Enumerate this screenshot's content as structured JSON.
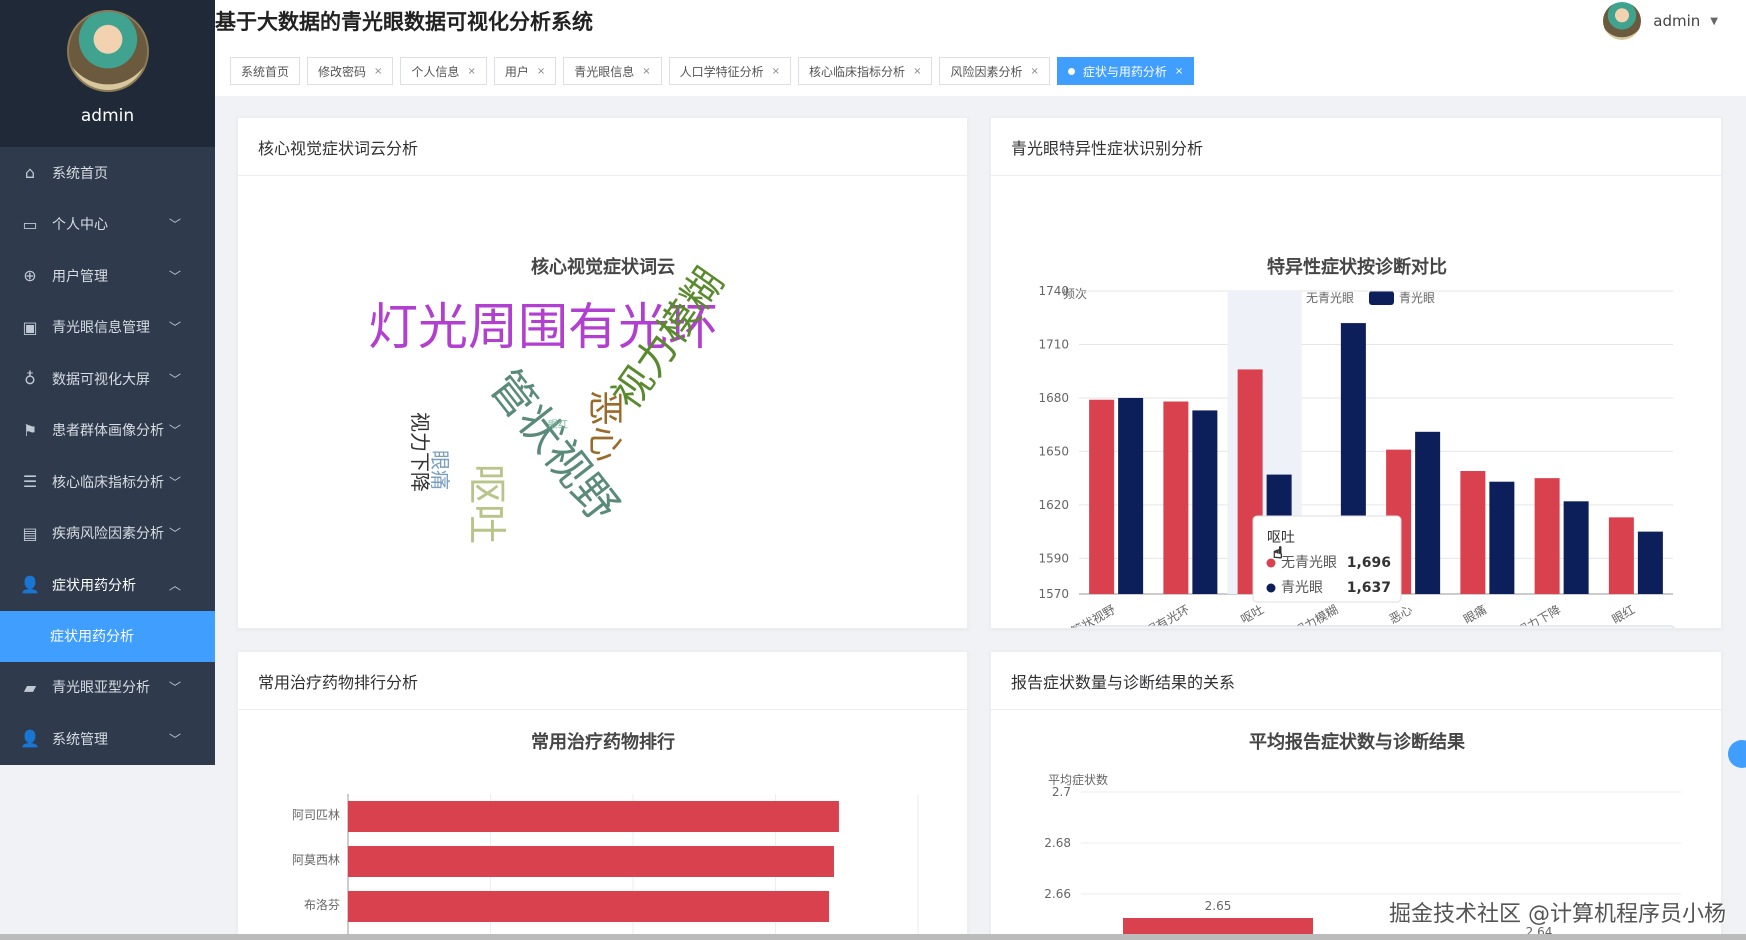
{
  "user": {
    "name": "admin"
  },
  "header": {
    "title": "基于大数据的青光眼数据可视化分析系统",
    "username": "admin"
  },
  "sidebar": {
    "items": [
      {
        "label": "系统首页",
        "icon": "home-icon",
        "chevron": false
      },
      {
        "label": "个人中心",
        "icon": "card-icon",
        "chevron": true
      },
      {
        "label": "用户管理",
        "icon": "globe-icon",
        "chevron": true
      },
      {
        "label": "青光眼信息管理",
        "icon": "clipboard-icon",
        "chevron": true
      },
      {
        "label": "数据可视化大屏",
        "icon": "mic-icon",
        "chevron": true
      },
      {
        "label": "患者群体画像分析",
        "icon": "flag-icon",
        "chevron": true
      },
      {
        "label": "核心临床指标分析",
        "icon": "list-icon",
        "chevron": true
      },
      {
        "label": "疾病风险因素分析",
        "icon": "window-icon",
        "chevron": true
      },
      {
        "label": "症状用药分析",
        "icon": "user-icon",
        "chevron": true,
        "open": true
      }
    ],
    "sub_item": "症状用药分析",
    "after_items": [
      {
        "label": "青光眼亚型分析",
        "icon": "stamp-icon",
        "chevron": true
      },
      {
        "label": "系统管理",
        "icon": "user-icon",
        "chevron": true
      }
    ]
  },
  "tabs": [
    {
      "label": "系统首页",
      "closable": false
    },
    {
      "label": "修改密码",
      "closable": true
    },
    {
      "label": "个人信息",
      "closable": true
    },
    {
      "label": "用户",
      "closable": true
    },
    {
      "label": "青光眼信息",
      "closable": true
    },
    {
      "label": "人口学特征分析",
      "closable": true
    },
    {
      "label": "核心临床指标分析",
      "closable": true
    },
    {
      "label": "风险因素分析",
      "closable": true
    },
    {
      "label": "症状与用药分析",
      "closable": true,
      "active": true
    }
  ],
  "cards": {
    "wordcloud": {
      "title": "核心视觉症状词云分析",
      "chart_title": "核心视觉症状词云",
      "words": [
        {
          "text": "灯光周围有光环",
          "color": "#b13fcf"
        },
        {
          "text": "管状视野",
          "color": "#5a8a7a"
        },
        {
          "text": "视力模糊",
          "color": "#5a8a2e"
        },
        {
          "text": "恶心",
          "color": "#9a6a2a"
        },
        {
          "text": "呕吐",
          "color": "#b9c48a"
        },
        {
          "text": "眼痛",
          "color": "#7b9fc0"
        },
        {
          "text": "视力下降",
          "color": "#333333"
        },
        {
          "text": "眼红",
          "color": "#7fb8a0"
        }
      ]
    },
    "specific": {
      "title": "青光眼特异性症状识别分析",
      "tooltip": {
        "category": "呕吐",
        "rows": [
          {
            "name": "无青光眼",
            "value": "1,696"
          },
          {
            "name": "青光眼",
            "value": "1,637"
          }
        ]
      }
    },
    "drugs": {
      "title": "常用治疗药物排行分析"
    },
    "relation": {
      "title": "报告症状数量与诊断结果的关系"
    }
  },
  "chart_data": [
    {
      "type": "bar",
      "title": "特异性症状按诊断对比",
      "ylabel": "频次",
      "categories": [
        "管状视野",
        "灯光周围有光环",
        "呕吐",
        "视力模糊",
        "恶心",
        "眼痛",
        "视力下降",
        "眼红"
      ],
      "xtick_labels": [
        "管状视野",
        "灯光周围有光环",
        "呕吐",
        "视力模糊",
        "恶心",
        "眼痛",
        "视力下降",
        "眼红"
      ],
      "series": [
        {
          "name": "无青光眼",
          "color": "#d9414f",
          "values": [
            1679,
            1678,
            1696,
            1560,
            1651,
            1639,
            1635,
            1613
          ]
        },
        {
          "name": "青光眼",
          "color": "#0d1f5a",
          "values": [
            1680,
            1673,
            1637,
            1722,
            1661,
            1633,
            1622,
            1605
          ]
        }
      ],
      "yticks": [
        1570,
        1590,
        1620,
        1650,
        1680,
        1710,
        1740
      ],
      "ylim": [
        1570,
        1740
      ],
      "legend": "top-center"
    },
    {
      "type": "bar",
      "orientation": "horizontal",
      "title": "常用治疗药物排行",
      "categories": [
        "阿司匹林",
        "阿莫西林",
        "布洛芬"
      ],
      "values": [
        0.99,
        0.98,
        0.97
      ],
      "color": "#d9414f"
    },
    {
      "type": "bar",
      "title": "平均报告症状数与诊断结果",
      "ylabel": "平均症状数",
      "yticks": [
        "2.7",
        "2.68",
        "2.66"
      ],
      "ylim": [
        2.64,
        2.7
      ],
      "values": [
        2.65
      ],
      "value_labels": [
        "2.65",
        "2.64"
      ],
      "color": "#d9414f"
    }
  ],
  "watermark": "掘金技术社区 @计算机程序员小杨"
}
